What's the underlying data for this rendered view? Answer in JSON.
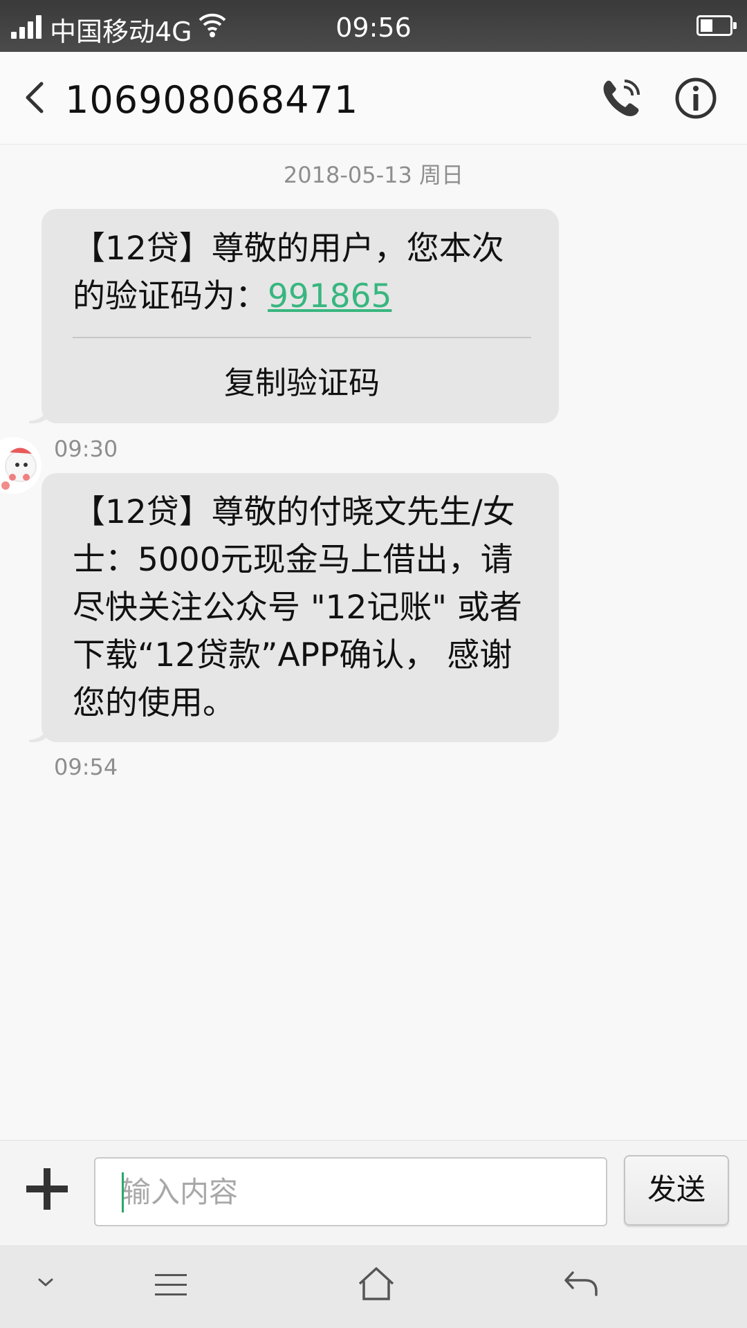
{
  "status_bar": {
    "carrier": "中国移动4G",
    "time": "09:56",
    "icons": [
      "signal-icon",
      "wifi-icon",
      "battery-icon"
    ]
  },
  "header": {
    "title": "106908068471",
    "icons": [
      "back-arrow-icon",
      "phone-call-icon",
      "info-icon"
    ]
  },
  "conversation": {
    "date_separator": "2018-05-13 周日",
    "messages": [
      {
        "text_before_code": "【12贷】尊敬的用户，您本次的验证码为：",
        "code": "991865",
        "copy_action": "复制验证码",
        "time": "09:30"
      },
      {
        "text": "【12贷】尊敬的付晓文先生/女士：5000元现金马上借出，请尽快关注公众号 \"12记账\" 或者 下载“12贷款”APP确认， 感谢您的使用。",
        "time": "09:54"
      }
    ]
  },
  "composer": {
    "placeholder": "输入内容",
    "value": "",
    "send_label": "发送",
    "icons": [
      "plus-icon"
    ]
  },
  "nav_bar": {
    "icons": [
      "collapse-chevron-icon",
      "menu-icon",
      "home-icon",
      "back-icon"
    ]
  },
  "colors": {
    "code_link": "#38b67f",
    "bubble": "#e6e6e6",
    "status_bar": "#404040"
  }
}
